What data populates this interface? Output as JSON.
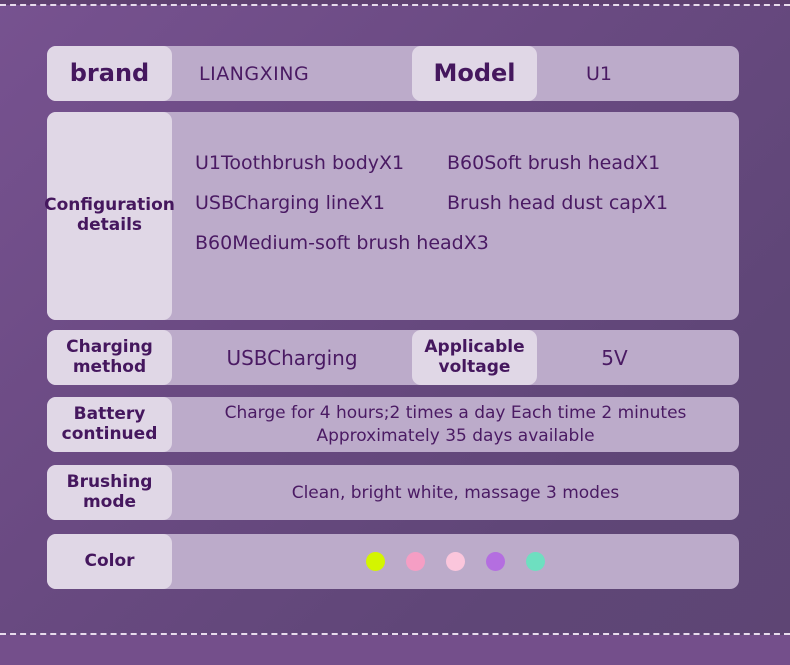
{
  "specs": {
    "brand": {
      "label": "brand",
      "value": "LIANGXING"
    },
    "model": {
      "label": "Model",
      "value": "U1"
    },
    "configuration": {
      "label": "Configuration details",
      "items": [
        "U1Toothbrush bodyX1",
        "B60Soft brush headX1",
        "USBCharging lineX1",
        "Brush head dust capX1",
        "B60Medium-soft brush headX3"
      ]
    },
    "charging_method": {
      "label": "Charging method",
      "value": "USBCharging"
    },
    "voltage": {
      "label": "Applicable voltage",
      "value": "5V"
    },
    "battery": {
      "label": "Battery continued",
      "line1": "Charge for 4 hours;2 times a day Each time 2 minutes",
      "line2": "Approximately 35 days available"
    },
    "brushing_mode": {
      "label": "Brushing mode",
      "value": "Clean, bright white, massage 3 modes"
    },
    "color": {
      "label": "Color",
      "swatches": [
        {
          "name": "lime",
          "hex": "#d4f500"
        },
        {
          "name": "pink",
          "hex": "#f59ec4"
        },
        {
          "name": "light-pink",
          "hex": "#fbc6dc"
        },
        {
          "name": "purple",
          "hex": "#b46ee0"
        },
        {
          "name": "mint",
          "hex": "#6edfc0"
        }
      ]
    }
  },
  "theme": {
    "background": "#6a4a82",
    "row_bg": "#bcabca",
    "label_bg": "#e0d7e6",
    "text": "#45175e"
  }
}
